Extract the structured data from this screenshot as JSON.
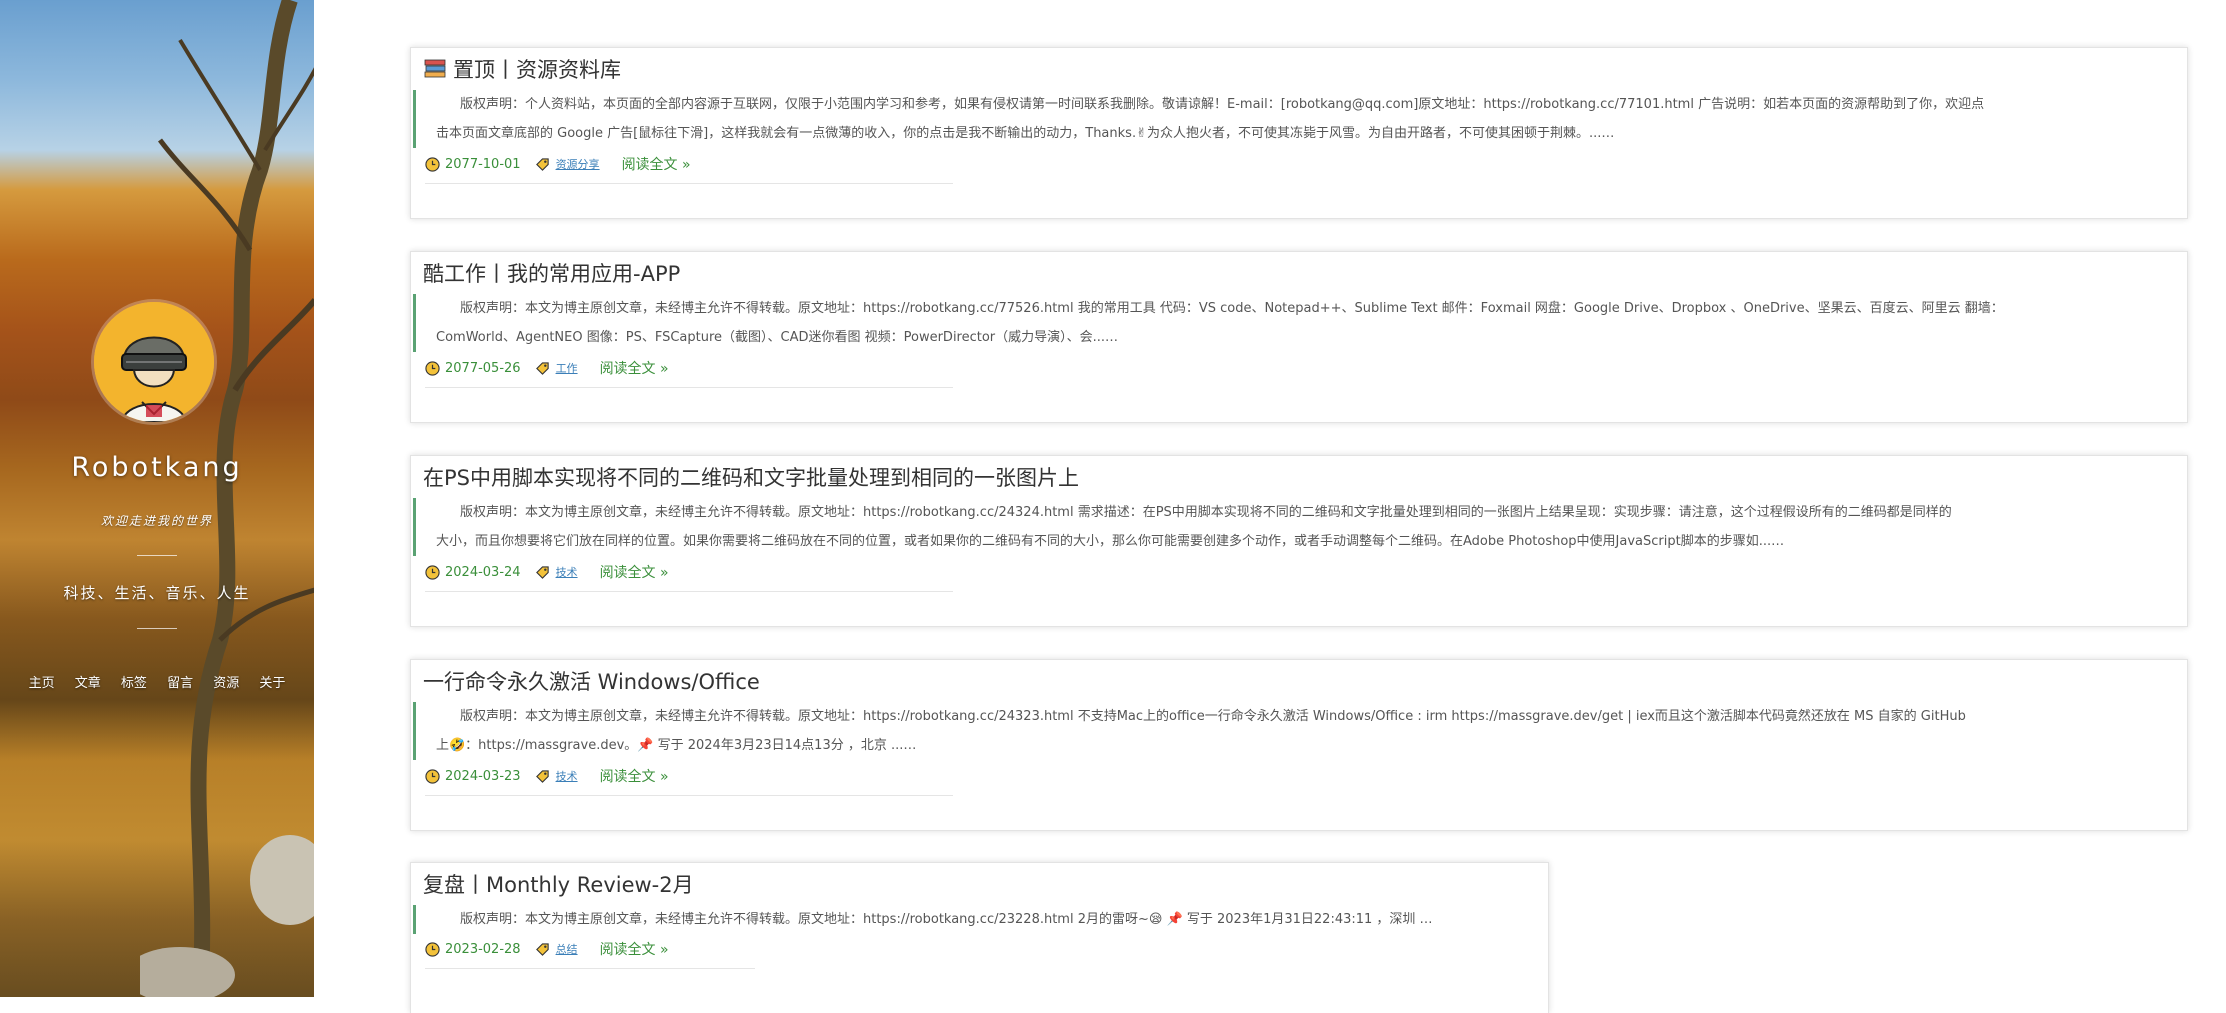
{
  "site": {
    "title": "Robotkang",
    "subtitle": "欢迎走进我的世界",
    "tagline": "科技、生活、音乐、人生"
  },
  "nav": [
    "主页",
    "文章",
    "标签",
    "留言",
    "资源",
    "关于"
  ],
  "posts": [
    {
      "title": "置顶丨资源资料库",
      "excerpt_line1": "版权声明：个人资料站，本页面的全部内容源于互联网，仅限于小范围内学习和参考，如果有侵权请第一时间联系我删除。敬请谅解！E-mail：[robotkang@qq.com]原文地址：https://robotkang.cc/77101.html 广告说明：如若本页面的资源帮助到了你，欢迎点",
      "excerpt_line2": "击本页面文章底部的 Google 广告[鼠标往下滑]，这样我就会有一点微薄的收入，你的点击是我不断输出的动力，Thanks.✌为众人抱火者，不可使其冻毙于风雪。为自由开路者，不可使其困顿于荆棘。...…",
      "date": "2077-10-01",
      "tag": "资源分享",
      "read_more": "阅读全文 »"
    },
    {
      "title": "酷工作丨我的常用应用-APP",
      "excerpt_line1": "版权声明：本文为博主原创文章，未经博主允许不得转载。原文地址：https://robotkang.cc/77526.html 我的常用工具 代码：VS code、Notepad++、Sublime Text 邮件：Foxmail 网盘：Google Drive、Dropbox 、OneDrive、坚果云、百度云、阿里云 翻墙：",
      "excerpt_line2": "ComWorld、AgentNEO 图像：PS、FSCapture（截图）、CAD迷你看图 视频：PowerDirector（威力导演）、会...…",
      "date": "2077-05-26",
      "tag": "工作",
      "read_more": "阅读全文 »"
    },
    {
      "title": "在PS中用脚本实现将不同的二维码和文字批量处理到相同的一张图片上",
      "excerpt_line1": "版权声明：本文为博主原创文章，未经博主允许不得转载。原文地址：https://robotkang.cc/24324.html 需求描述：在PS中用脚本实现将不同的二维码和文字批量处理到相同的一张图片上结果呈现：实现步骤：请注意，这个过程假设所有的二维码都是同样的",
      "excerpt_line2": "大小，而且你想要将它们放在同样的位置。如果你需要将二维码放在不同的位置，或者如果你的二维码有不同的大小，那么你可能需要创建多个动作，或者手动调整每个二维码。在Adobe Photoshop中使用JavaScript脚本的步骤如...…",
      "date": "2024-03-24",
      "tag": "技术",
      "read_more": "阅读全文 »"
    },
    {
      "title": "一行命令永久激活 Windows/Office",
      "excerpt_line1": "版权声明：本文为博主原创文章，未经博主允许不得转载。原文地址：https://robotkang.cc/24323.html 不支持Mac上的office一行命令永久激活 Windows/Office : irm https://massgrave.dev/get | iex而且这个激活脚本代码竟然还放在 MS 自家的 GitHub",
      "excerpt_line2": "上🤣：https://massgrave.dev。📌 写于 2024年3月23日14点13分 ，北京 ...…",
      "date": "2024-03-23",
      "tag": "技术",
      "read_more": "阅读全文 »"
    },
    {
      "title": "复盘丨Monthly Review-2月",
      "excerpt_line1": "版权声明：本文为博主原创文章，未经博主允许不得转载。原文地址：https://robotkang.cc/23228.html 2月的雷呀~😪 📌 写于 2023年1月31日22:43:11 ，深圳 …",
      "excerpt_line2": "",
      "date": "2023-02-28",
      "tag": "总结",
      "read_more": "阅读全文 »"
    }
  ]
}
